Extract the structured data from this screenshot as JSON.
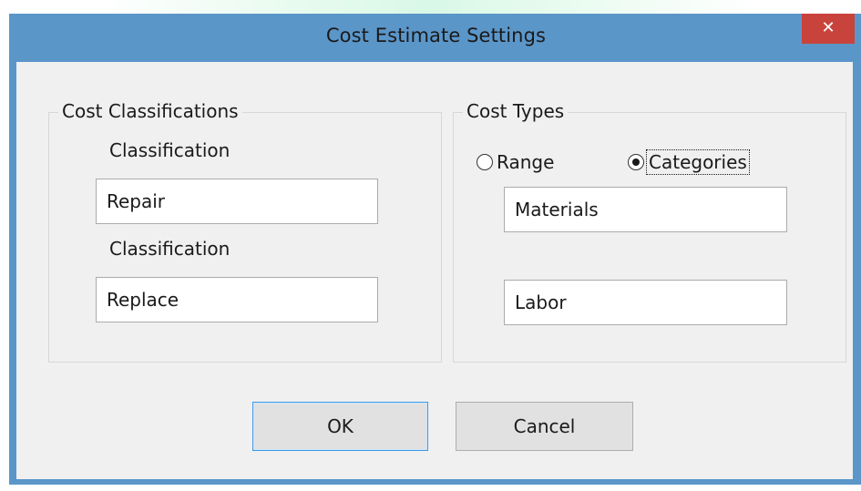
{
  "window": {
    "title": "Cost Estimate Settings",
    "close_glyph": "✕"
  },
  "classifications": {
    "group_label": "Cost Classifications",
    "items": [
      {
        "label": "Classification",
        "value": "Repair"
      },
      {
        "label": "Classification",
        "value": "Replace"
      }
    ]
  },
  "cost_types": {
    "group_label": "Cost Types",
    "options": [
      {
        "label": "Range",
        "selected": false
      },
      {
        "label": "Categories",
        "selected": true
      }
    ],
    "fields": [
      {
        "value": "Materials"
      },
      {
        "value": "Labor"
      }
    ]
  },
  "buttons": {
    "ok_label": "OK",
    "cancel_label": "Cancel"
  },
  "colors": {
    "titlebar": "#5b96c9",
    "close": "#c8433b",
    "client": "#f0f0f0",
    "default_button_border": "#3c9ae8"
  }
}
